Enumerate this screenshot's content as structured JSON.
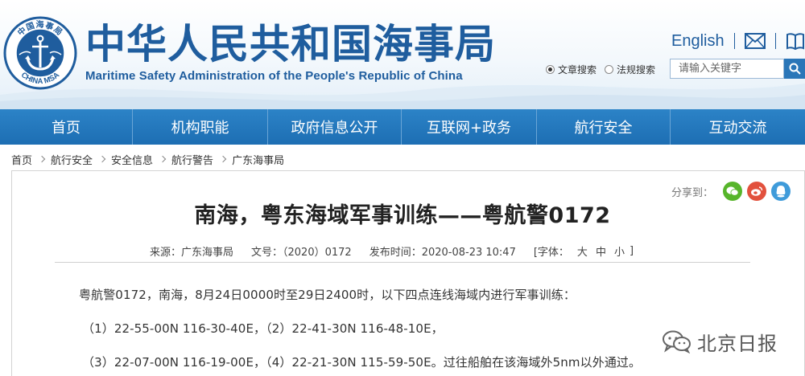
{
  "header": {
    "title": "中华人民共和国海事局",
    "subtitle": "Maritime Safety Administration of the People's Republic of China",
    "emblem": {
      "top_text": "中国海事局",
      "bottom_text": "CHINA MSA",
      "icon": "anchor-emblem-icon"
    },
    "english_link": "English",
    "mail_icon": "mail-icon",
    "book_icon": "book-icon",
    "search": {
      "options": [
        {
          "label": "文章搜索",
          "selected": true
        },
        {
          "label": "法规搜索",
          "selected": false
        }
      ],
      "placeholder": "请输入关键字",
      "button_icon": "search-icon"
    }
  },
  "nav": {
    "items": [
      "首页",
      "机构职能",
      "政府信息公开",
      "互联网+政务",
      "航行安全",
      "互动交流"
    ]
  },
  "breadcrumb": [
    "首页",
    "航行安全",
    "安全信息",
    "航行警告",
    "广东海事局"
  ],
  "share": {
    "label": "分享到：",
    "targets": [
      "wechat-icon",
      "weibo-icon",
      "qq-icon"
    ]
  },
  "article": {
    "title": "南海，粤东海域军事训练——粤航警0172",
    "meta": {
      "source": "来源：广东海事局",
      "doc_no": "文号：（2020）0172",
      "published": "发布时间：2020-08-23 10:47",
      "font_label": "[字体：",
      "font_large": "大",
      "font_medium": "中",
      "font_small": "小",
      "font_close": "]"
    },
    "paragraphs": [
      "粤航警0172，南海，8月24日0000时至29日2400时，以下四点连线海域内进行军事训练：",
      "（1）22-55-00N 116-30-40E，（2）22-41-30N 116-48-10E，",
      "（3）22-07-00N 116-19-00E，（4）22-21-30N 115-59-50E。过往船舶在该海域外5nm以外通过。"
    ]
  },
  "watermark": {
    "text": "北京日报",
    "icon": "wechat-logo-icon"
  },
  "colors": {
    "brand_blue": "#1f5d9e",
    "nav_blue": "#1d6eb3",
    "accent": "#2a76b8"
  }
}
